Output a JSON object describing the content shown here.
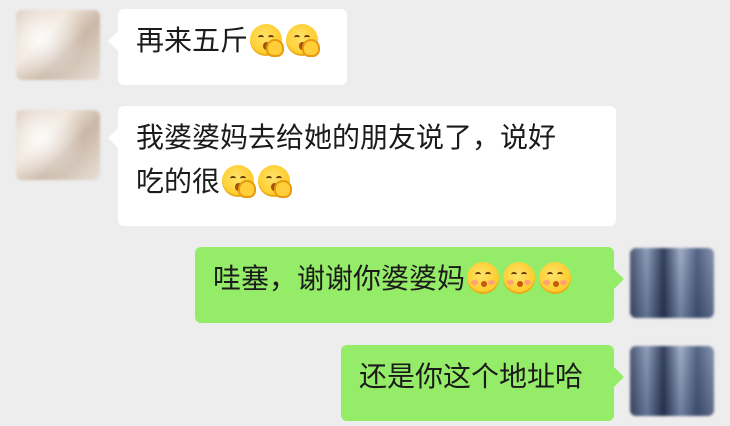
{
  "messages": [
    {
      "side": "received",
      "text_lines": [
        "再来五斤"
      ],
      "emojis": [
        "thinking-hand-icon",
        "thinking-hand-icon"
      ]
    },
    {
      "side": "received",
      "text_lines": [
        "我婆婆妈去给她的朋友说了，说好",
        "吃的很"
      ],
      "emojis": [
        "thinking-hand-icon",
        "thinking-hand-icon"
      ]
    },
    {
      "side": "sent",
      "text_lines": [
        "哇塞，谢谢你婆婆妈"
      ],
      "emojis": [
        "kissing-face-icon",
        "kissing-face-icon",
        "kissing-face-icon"
      ]
    },
    {
      "side": "sent",
      "text_lines": [
        "还是你这个地址哈"
      ],
      "emojis": []
    }
  ],
  "colors": {
    "background": "#ededed",
    "received_bubble": "#ffffff",
    "sent_bubble": "#95ec69",
    "text": "#1b1b1b"
  }
}
